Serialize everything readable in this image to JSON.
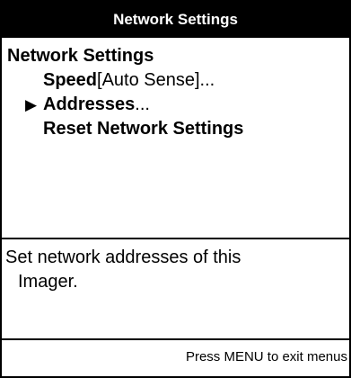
{
  "window": {
    "title": "Network Settings"
  },
  "menu": {
    "heading": "Network Settings",
    "items": [
      {
        "name": "Speed",
        "suffix": " [Auto Sense]...",
        "selected": false
      },
      {
        "name": "Addresses",
        "suffix": "...",
        "selected": true
      },
      {
        "name": "Reset Network Settings",
        "suffix": "",
        "selected": false
      }
    ],
    "pointer_glyph": "▶"
  },
  "help": {
    "line1": "Set network addresses of this",
    "line2": "Imager."
  },
  "footer": {
    "hint": "Press MENU to exit menus"
  },
  "colors": {
    "title_bg": "#000000",
    "title_fg": "#ffffff",
    "border": "#000000"
  }
}
